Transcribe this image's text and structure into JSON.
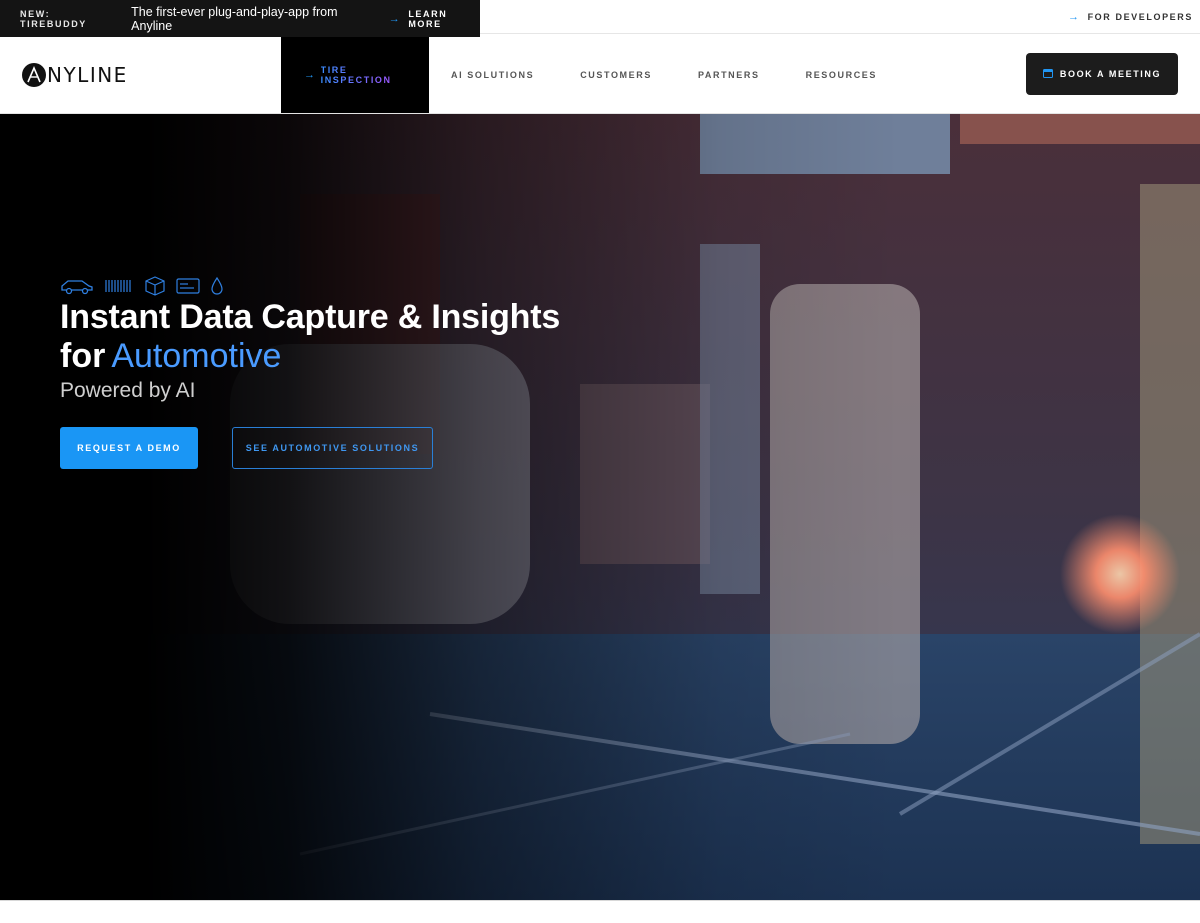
{
  "announcement": {
    "tag": "NEW: TIREBUDDY",
    "message": "The first-ever plug-and-play-app from Anyline",
    "learn_more": "LEARN MORE",
    "for_developers": "FOR DEVELOPERS"
  },
  "nav": {
    "logo_text": "NYLINE",
    "items": [
      {
        "label": "TIRE INSPECTION",
        "active": true
      },
      {
        "label": "AI SOLUTIONS"
      },
      {
        "label": "CUSTOMERS"
      },
      {
        "label": "PARTNERS"
      },
      {
        "label": "RESOURCES"
      }
    ],
    "book_meeting": "BOOK A MEETING"
  },
  "hero": {
    "icons": [
      "car-icon",
      "barcode-icon",
      "package-icon",
      "id-card-icon",
      "drop-icon"
    ],
    "headline_line1": "Instant Data Capture & Insights",
    "headline_for": "for",
    "headline_accent": "Automotive",
    "subheadline": "Powered by AI",
    "primary_cta": "REQUEST A DEMO",
    "secondary_cta": "SEE AUTOMOTIVE SOLUTIONS"
  },
  "colors": {
    "accent_blue": "#1a96f5",
    "accent_text_blue": "#4a9bff",
    "dark": "#141414"
  }
}
